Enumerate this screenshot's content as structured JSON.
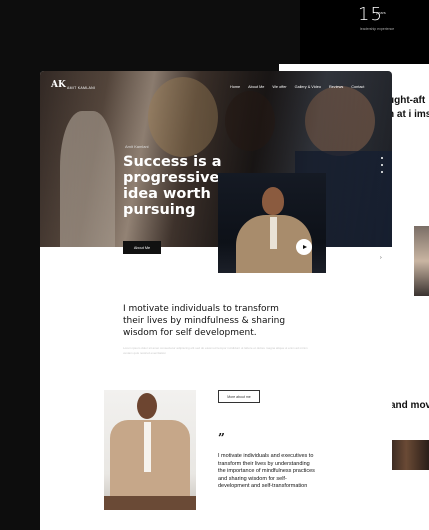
{
  "back_card_top": {
    "stat_number": "15",
    "stat_unit": "years",
    "stat_label": "leadership experience"
  },
  "back_card_right": {
    "heading_line1": "ught-aft",
    "heading_line2": "h at i ims",
    "heading_bottom": "and movi"
  },
  "header": {
    "logo_glyph": "AK",
    "logo_text": "AMIT KAMLANI",
    "nav": [
      "Home",
      "About Me",
      "We offer",
      "Gallery & Video",
      "Reviews",
      "Contact"
    ]
  },
  "hero": {
    "eyebrow": "Amit Kamlani",
    "title": "Success is a progressive idea worth pursuing",
    "button_label": "About Me",
    "side_arrow": "›"
  },
  "intro": {
    "heading": "I motivate individuals to transform their lives by mindfulness & sharing wisdom for self development.",
    "sub": "Lorem ipsum dolor sit amet consectetur adipiscing elit sed do eiusmod tempor incididunt ut labore et dolore magna aliqua ut enim ad minim veniam quis nostrud exercitation"
  },
  "about": {
    "button_label": "More about me",
    "quote_mark": "”",
    "quote": "I motivate individuals and executives to transform their lives by understanding the importance of mindfulness practices and sharing wisdom for self-development and self-transformation"
  }
}
